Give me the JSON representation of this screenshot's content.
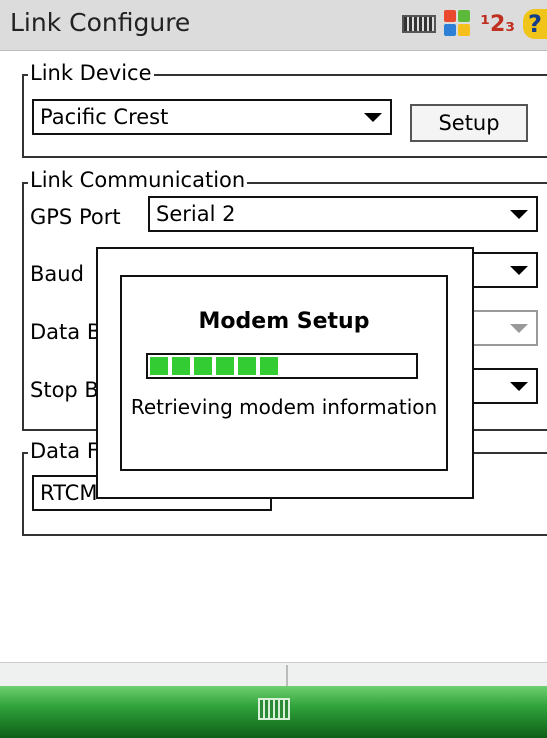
{
  "window": {
    "title": "Link Configure"
  },
  "tray": {
    "input_mode": "¹2₃",
    "help": "?"
  },
  "link_device": {
    "legend": "Link Device",
    "device_value": "Pacific Crest",
    "setup_label": "Setup"
  },
  "link_comm": {
    "legend": "Link Communication",
    "gps_port_label": "GPS Port",
    "gps_port_value": "Serial 2",
    "baud_label": "Baud",
    "data_bits_label": "Data B",
    "stop_bits_label": "Stop B"
  },
  "data_format": {
    "legend": "Data F",
    "value": "RTCM"
  },
  "modal": {
    "title": "Modem Setup",
    "progress_segments": 6,
    "status": "Retrieving modem information"
  },
  "colors": {
    "progress": "#33cc33",
    "taskbar": "#2fa23a"
  }
}
